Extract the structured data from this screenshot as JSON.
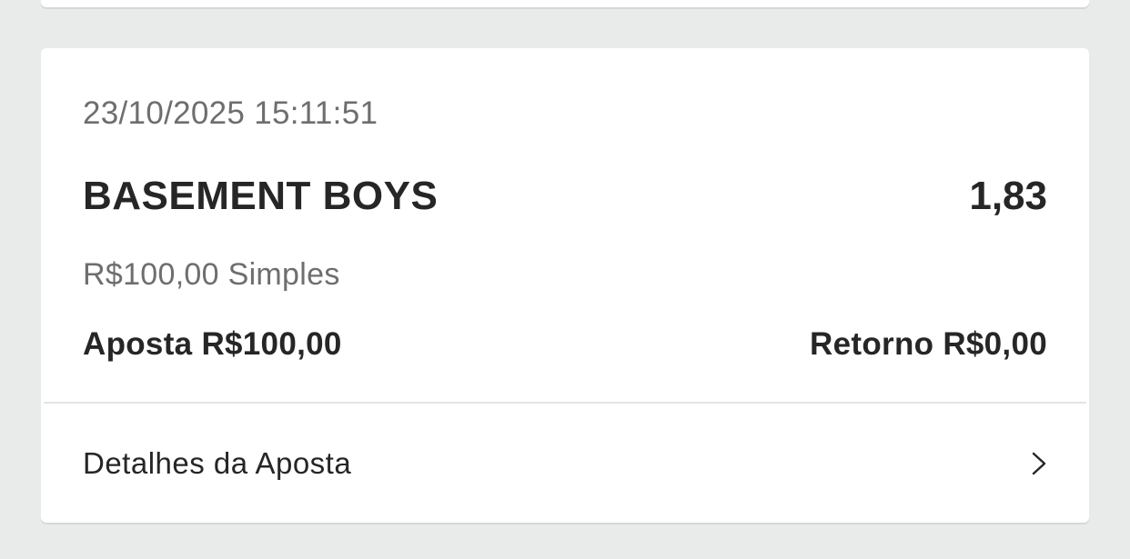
{
  "bet": {
    "timestamp": "23/10/2025 15:11:51",
    "selection": "BASEMENT BOYS",
    "odds": "1,83",
    "stake_type": "R$100,00 Simples",
    "stake": "Aposta R$100,00",
    "return": "Retorno R$0,00",
    "details_label": "Detalhes da Aposta"
  },
  "icons": {
    "details_chevron": "chevron-right-icon"
  },
  "colors": {
    "page_background": "#e9ebea",
    "card_background": "#ffffff",
    "primary_text": "#262626",
    "secondary_text": "#6e6e6e"
  }
}
